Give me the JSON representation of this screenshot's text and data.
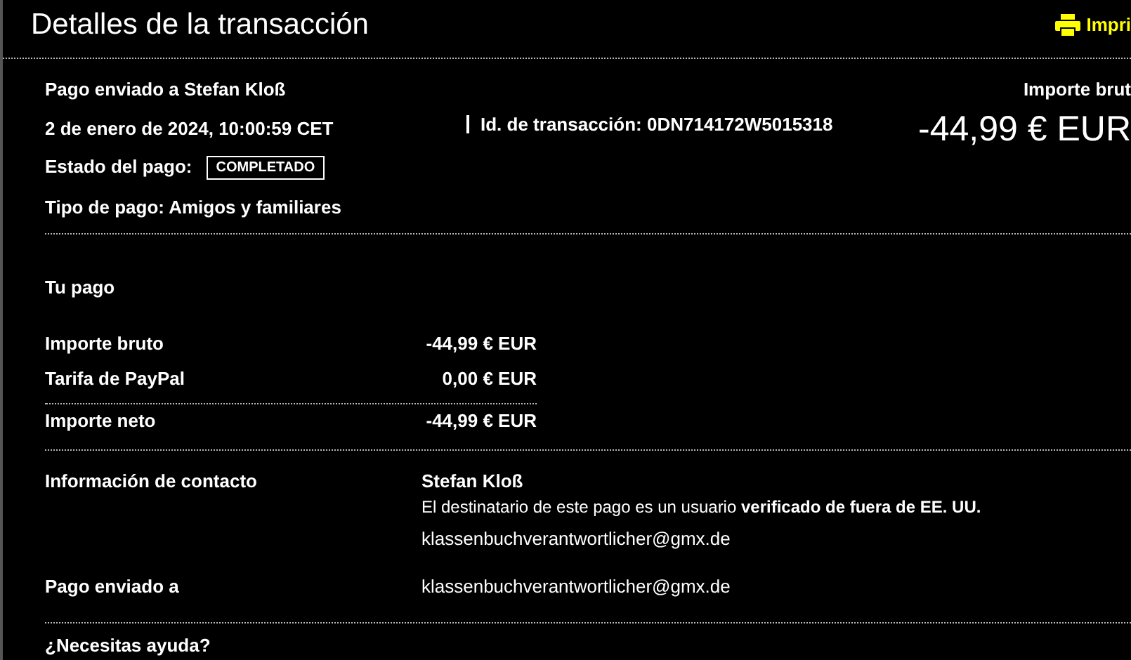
{
  "header": {
    "title": "Detalles de la transacción",
    "print_link": "Impri"
  },
  "summary": {
    "recipient": "Pago enviado a Stefan Kloß",
    "date": "2 de enero de 2024, 10:00:59 CET",
    "transaction_id": "Id. de transacción: 0DN714172W5015318",
    "status_label": "Estado del pago:",
    "status": "COMPLETADO",
    "payment_type": "Tipo de pago: Amigos y familiares",
    "amount_label": "Importe brut",
    "amount": "-44,99 € EUR"
  },
  "payment": {
    "title": "Tu pago",
    "rows": [
      {
        "label": "Importe bruto",
        "value": "-44,99 € EUR",
        "total": false
      },
      {
        "label": "Tarifa de PayPal",
        "value": "0,00 € EUR",
        "total": false
      },
      {
        "label": "Importe neto",
        "value": "-44,99 € EUR",
        "total": true
      }
    ]
  },
  "contact": {
    "label": "Información de contacto",
    "name": "Stefan Kloß",
    "note": "El destinatario de este pago es un usuario **verificado de fuera de EE. UU.**",
    "email": "klassenbuchverantwortlicher@gmx.de"
  },
  "sent_to": {
    "label": "Pago enviado a",
    "email": "klassenbuchverantwortlicher@gmx.de"
  },
  "help": {
    "title": "¿Necesitas ayuda?"
  }
}
